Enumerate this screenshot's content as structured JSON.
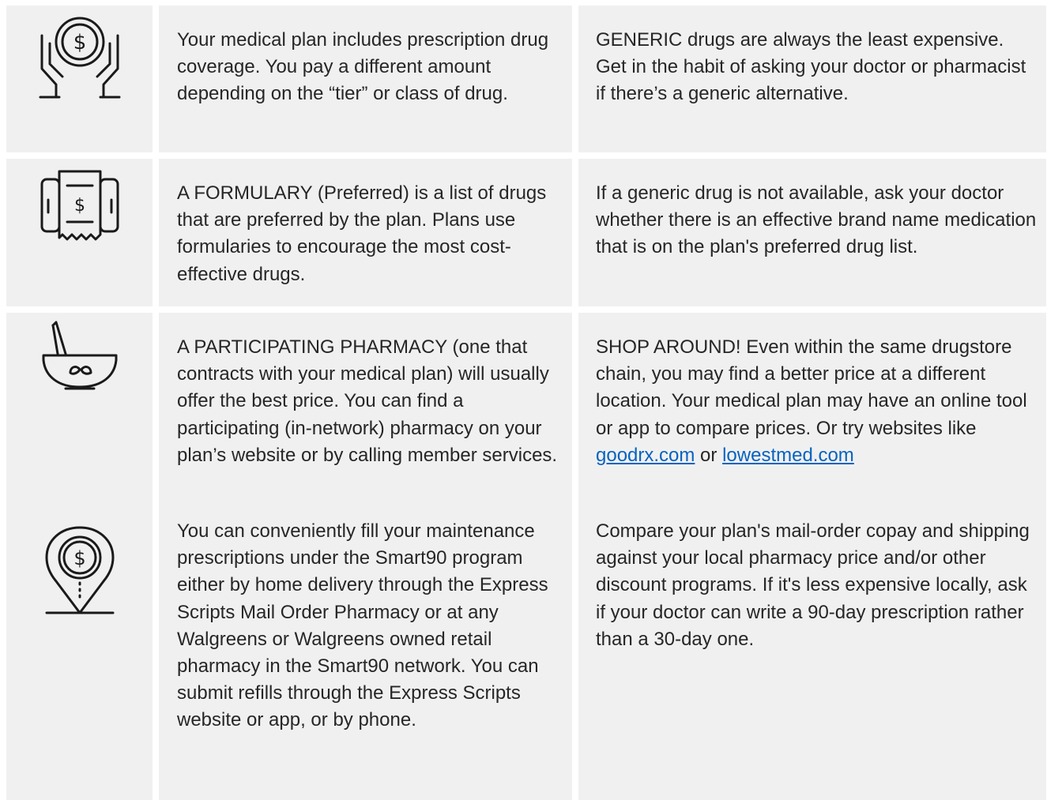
{
  "rows": [
    {
      "icon": "hands-holding-coin-icon",
      "left": "Your medical plan includes prescription drug coverage. You pay a different amount depending on the “tier” or class of drug.",
      "right": "GENERIC drugs are always the least expensive. Get in the habit of asking your doctor or pharmacist if there’s a generic alternative."
    },
    {
      "icon": "phone-receipt-icon",
      "left": "A FORMULARY (Preferred) is a list of drugs that are preferred by the plan. Plans use formularies to encourage the most cost-effective drugs.",
      "right": "If a generic drug is not available, ask your doctor whether there is an effective brand name medication that is on the plan's preferred drug list."
    },
    {
      "icon": "mortar-pestle-icon",
      "left": "A PARTICIPATING PHARMACY (one that contracts with your medical plan) will usually offer the best price. You can find a participating (in-network) pharmacy on your plan’s website or by calling member services.",
      "right_prefix": "SHOP AROUND! Even within the same drugstore chain, you may find a better price at a different location. Your medical plan may have an online tool or app to compare prices. Or try websites like ",
      "link1": "goodrx.com",
      "right_mid": " or ",
      "link2": "lowestmed.com"
    },
    {
      "icon": "location-pin-dollar-icon",
      "left": "You can conveniently fill your maintenance prescriptions under the Smart90 program either by home delivery through the Express Scripts Mail Order Pharmacy or at any Walgreens or Walgreens owned retail pharmacy in the Smart90 network.  You can submit refills through the Express Scripts website or app, or by phone.",
      "right": "Compare your plan's mail-order copay and shipping against your local pharmacy price and/or other discount programs. If it's less expensive locally, ask if your doctor can write a 90-day prescription rather than a 30-day one."
    }
  ],
  "colors": {
    "cell_bg": "#f0f0f0",
    "text": "#262626",
    "link": "#0563c1"
  }
}
